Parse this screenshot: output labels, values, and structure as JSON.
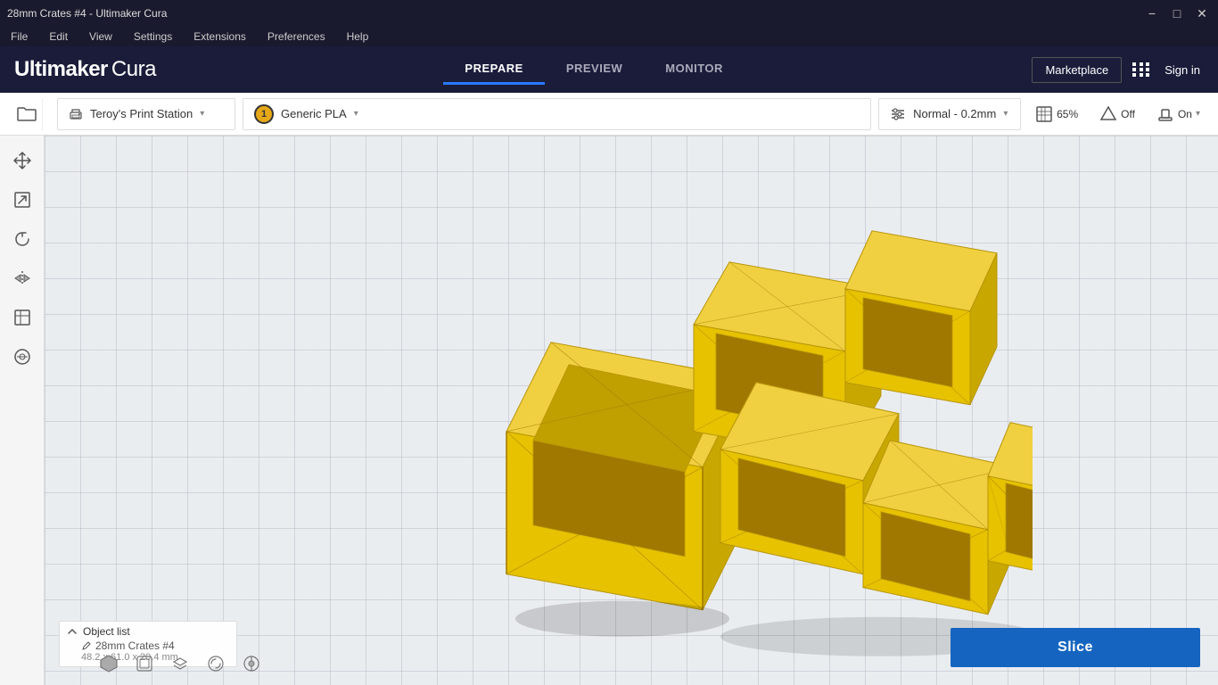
{
  "window": {
    "title": "28mm Crates #4 - Ultimaker Cura"
  },
  "titlebar": {
    "minimize": "−",
    "maximize": "□",
    "close": "✕"
  },
  "menubar": {
    "items": [
      "File",
      "Edit",
      "View",
      "Settings",
      "Extensions",
      "Preferences",
      "Help"
    ]
  },
  "header": {
    "logo_bold": "Ultimaker",
    "logo_light": " Cura",
    "tabs": [
      {
        "label": "PREPARE",
        "active": true
      },
      {
        "label": "PREVIEW",
        "active": false
      },
      {
        "label": "MONITOR",
        "active": false
      }
    ],
    "marketplace_label": "Marketplace",
    "signin_label": "Sign in"
  },
  "toolbar": {
    "printer": "Teroy's Print Station",
    "material_number": "1",
    "material_name": "Generic PLA",
    "settings_label": "Normal - 0.2mm",
    "infill_label": "65%",
    "support_label": "Off",
    "adhesion_label": "On"
  },
  "sidebar": {
    "tools": [
      {
        "name": "move",
        "icon": "✛"
      },
      {
        "name": "scale",
        "icon": "⊡"
      },
      {
        "name": "rotate",
        "icon": "↺"
      },
      {
        "name": "mirror",
        "icon": "⊣⊢"
      },
      {
        "name": "support",
        "icon": "⊞"
      },
      {
        "name": "custom-support",
        "icon": "⊙"
      }
    ]
  },
  "status": {
    "object_list_label": "Object list",
    "object_name": "28mm Crates #4",
    "object_dims": "48.2 x 61.0 x 20.4 mm"
  },
  "slice_button": "Slice",
  "colors": {
    "header_bg": "#1a1c3a",
    "accent_blue": "#2979ff",
    "model_yellow": "#e6c200",
    "slice_blue": "#1565c0"
  }
}
